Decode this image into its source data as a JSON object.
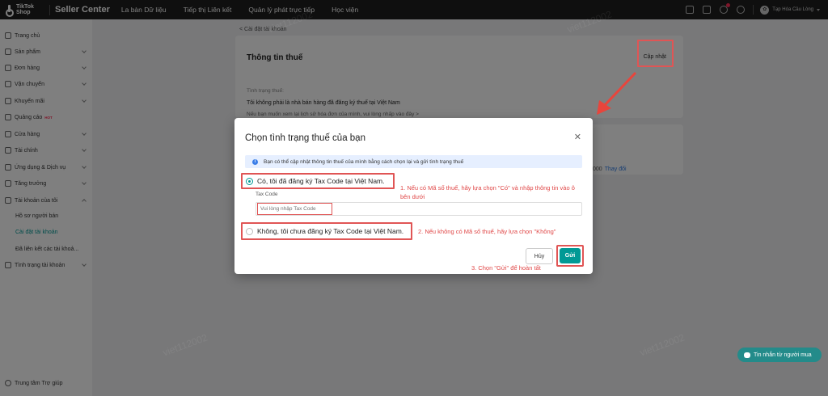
{
  "topbar": {
    "logo_line1": "TikTok",
    "logo_line2": "Shop",
    "app_title": "Seller Center",
    "nav": [
      "La bàn Dữ liệu",
      "Tiếp thị Liên kết",
      "Quản lý phát trực tiếp",
      "Học viện"
    ],
    "shop_name": "Tạp Hóa Cầu Lòng"
  },
  "sidebar": {
    "items": [
      {
        "label": "Trang chủ",
        "icon": "home-icon"
      },
      {
        "label": "Sản phẩm",
        "icon": "product-icon"
      },
      {
        "label": "Đơn hàng",
        "icon": "order-icon"
      },
      {
        "label": "Vận chuyển",
        "icon": "shipping-icon"
      },
      {
        "label": "Khuyến mãi",
        "icon": "promotion-icon"
      },
      {
        "label": "Quảng cáo",
        "icon": "ads-icon",
        "badge": "HOT"
      },
      {
        "label": "Cửa hàng",
        "icon": "store-icon"
      },
      {
        "label": "Tài chính",
        "icon": "finance-icon"
      },
      {
        "label": "Ứng dụng & Dịch vụ",
        "icon": "apps-icon"
      },
      {
        "label": "Tăng trưởng",
        "icon": "growth-icon"
      },
      {
        "label": "Tài khoản của tôi",
        "icon": "account-icon"
      }
    ],
    "subitems": [
      "Hồ sơ người bán",
      "Cài đặt tài khoản",
      "Đã liên kết các tài khoả..."
    ],
    "last_item": "Tình trạng tài khoản",
    "help": "Trung tâm Trợ giúp"
  },
  "page": {
    "back_link": "< Cài đặt tài khoản",
    "card_title": "Thông tin thuế",
    "update_link": "Cập nhật",
    "tax_status_label": "Tình trạng thuế:",
    "tax_status_value": "Tôi không phải là nhà bán hàng đã đăng ký thuế tại Việt Nam",
    "view_history": "Nếu bạn muốn xem lại lịch sử hóa đơn của mình, vui lòng nhấp vào đây >",
    "change_num": "000",
    "change_link": "Thay đổi"
  },
  "modal": {
    "title": "Chọn tình trạng thuế của bạn",
    "info": "Bạn có thể cập nhật thông tin thuế của mình bằng cách chọn lại và gửi tình trạng thuế",
    "option_yes": "Có, tôi đã đăng ký Tax Code tại Việt Nam.",
    "option_no": "Không, tôi chưa đăng ký Tax Code tại Việt Nam.",
    "tax_code_label": "Tax Code",
    "tax_code_placeholder": "Vui lòng nhập Tax Code",
    "cancel": "Hủy",
    "submit": "Gửi"
  },
  "annotations": {
    "step1": "1. Nếu có Mã số thuế, hãy lựa chọn \"Có\" và nhập thông tin vào ô bên dưới",
    "step2": "2. Nếu không có Mã số thuế, hãy lựa chọn \"Không\"",
    "step3": "3. Chọn \"Gửi\" để hoàn tất"
  },
  "chat": {
    "label": "Tin nhắn từ người mua"
  },
  "watermark": "viet112002",
  "colors": {
    "brand": "#009995",
    "annotation": "#e05555",
    "info_bg": "#e6efff",
    "topbar": "#1f1f1f"
  }
}
